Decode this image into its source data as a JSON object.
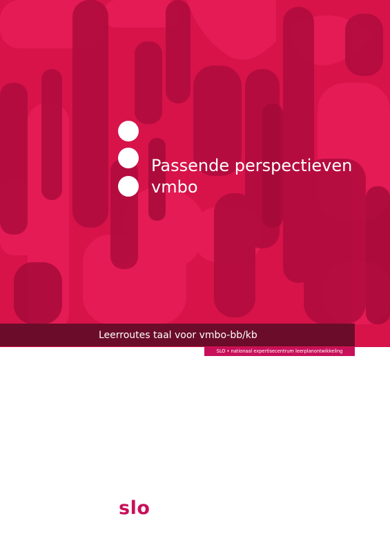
{
  "cover": {
    "title_line1": "Passende perspectieven",
    "title_line2": "vmbo",
    "subtitle": "Leerroutes taal voor vmbo-bb/kb",
    "organisation_tag": "SLO • nationaal expertisecentrum leerplanontwikkeling",
    "logo_text": "slo"
  },
  "colors": {
    "cover_background": "#d7134a",
    "subtitle_band": "#6b0c2a",
    "brand_magenta": "#c8105a"
  }
}
